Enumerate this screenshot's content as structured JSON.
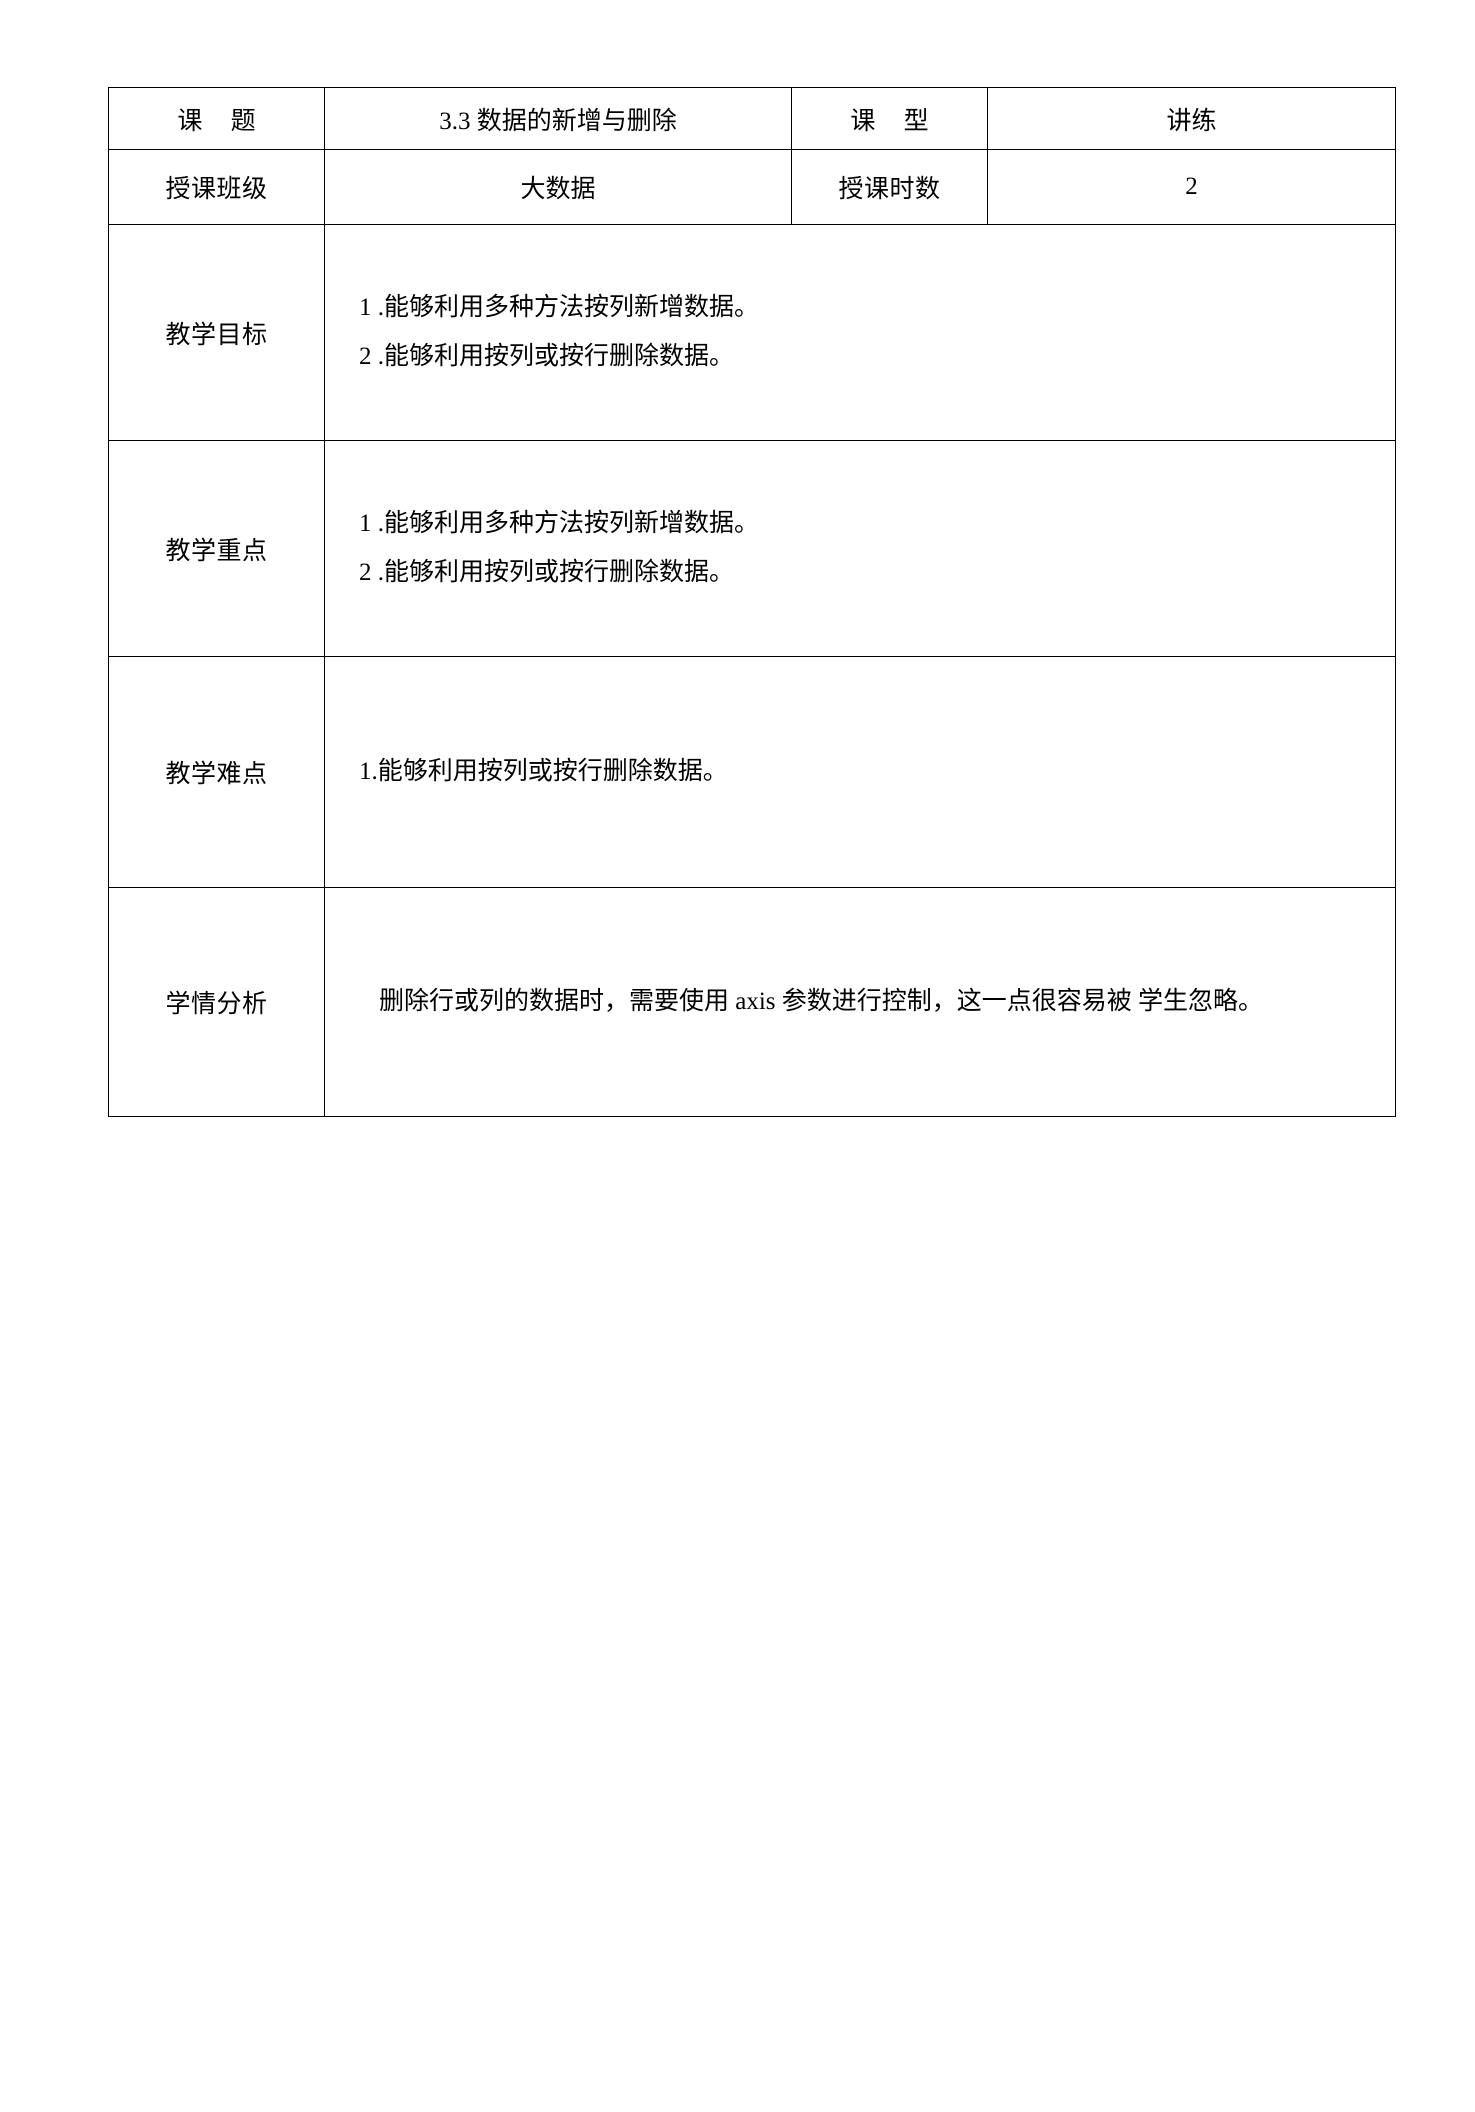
{
  "document": {
    "type": "lesson-plan-table",
    "row_labels": {
      "topic": "课  题",
      "class_type": "课  型",
      "teaching_class": "授课班级",
      "teaching_hours": "授课时数",
      "objectives": "教学目标",
      "key_points": "教学重点",
      "difficult_points": "教学难点",
      "student_analysis": "学情分析"
    },
    "values": {
      "topic": "3.3 数据的新增与删除",
      "class_type": "讲练",
      "teaching_class": "大数据",
      "teaching_hours": "2"
    },
    "objectives": [
      "1 .能够利用多种方法按列新增数据。",
      "2 .能够利用按列或按行删除数据。"
    ],
    "key_points": [
      "1 .能够利用多种方法按列新增数据。",
      "2 .能够利用按列或按行删除数据。"
    ],
    "difficult_points": [
      "1.能够利用按列或按行删除数据。"
    ],
    "student_analysis": "删除行或列的数据时，需要使用 axis 参数进行控制，这一点很容易被 学生忽略。"
  },
  "colors": {
    "text": "#000000",
    "border": "#000000",
    "background": "#ffffff"
  }
}
